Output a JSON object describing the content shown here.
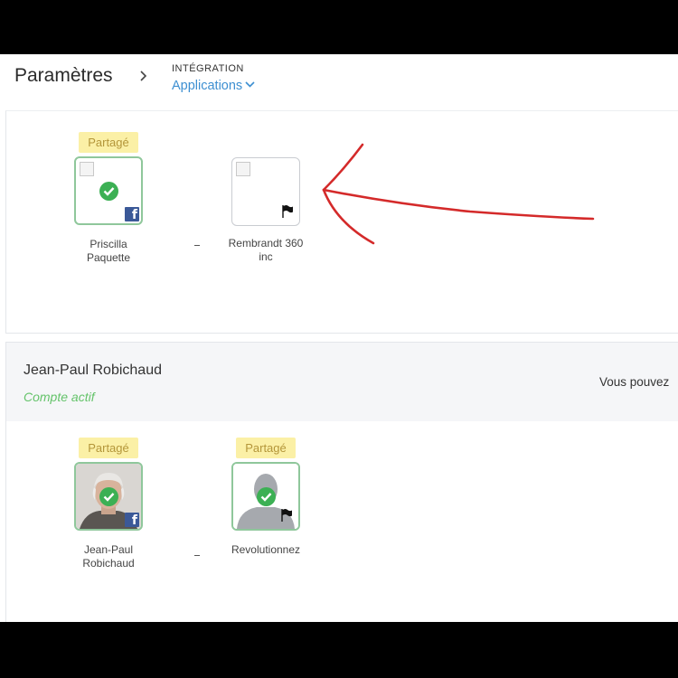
{
  "header": {
    "title": "Paramètres",
    "breadcrumb_separator": "›",
    "section": "INTÉGRATION",
    "subsection": "Applications"
  },
  "card1": {
    "left_node": {
      "badge": "Partagé",
      "name": "Priscilla\nPaquette",
      "network": "facebook",
      "status": "connected"
    },
    "connector": "-",
    "right_node": {
      "name": "Rembrandt 360\ninc",
      "network": "flag"
    }
  },
  "card2": {
    "person_name": "Jean-Paul Robichaud",
    "status": "Compte actif",
    "note": "Vous pouvez",
    "left_node": {
      "badge": "Partagé",
      "name": "Jean-Paul\nRobichaud",
      "network": "facebook",
      "status": "connected"
    },
    "connector": "-",
    "right_node": {
      "badge": "Partagé",
      "name": "Revolutionnez",
      "network": "flag",
      "status": "connected"
    }
  },
  "colors": {
    "link": "#3d8fd1",
    "badge_bg": "#fbf0a6",
    "active_green": "#64c36a",
    "check_green": "#3cb054",
    "annotation_red": "#d42a2a"
  }
}
